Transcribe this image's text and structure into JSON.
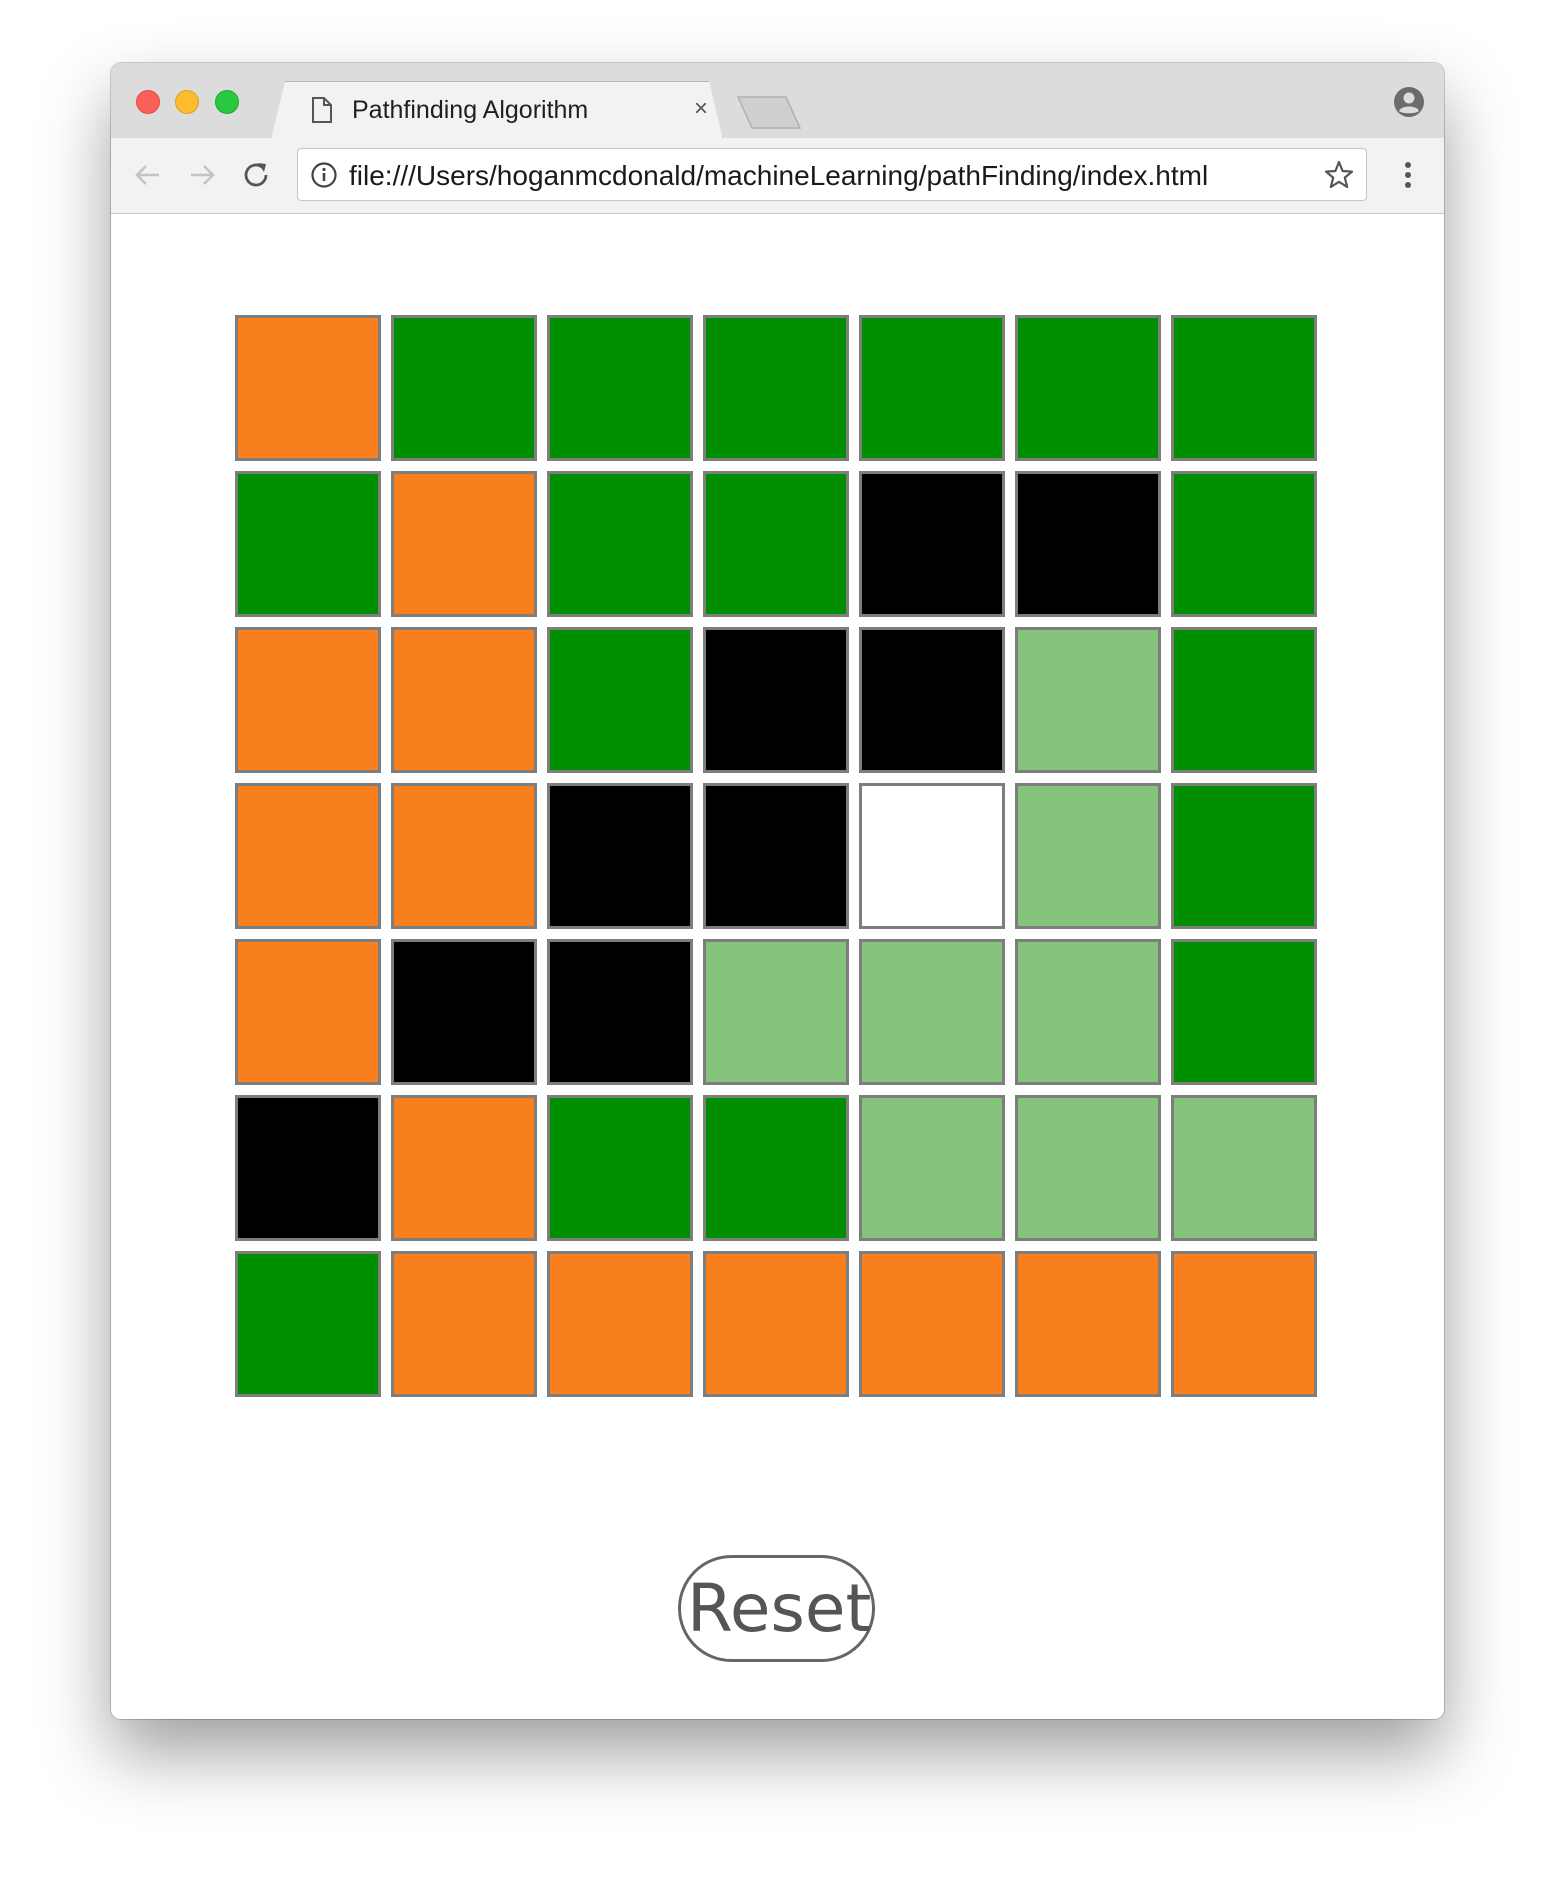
{
  "browser": {
    "tab_title": "Pathfinding Algorithm",
    "tab_close": "×",
    "url": "file:///Users/hoganmcdonald/machineLearning/pathFinding/index.html"
  },
  "icons": {
    "tab": "document-icon",
    "back": "back-arrow-icon",
    "forward": "forward-arrow-icon",
    "reload": "reload-icon",
    "info": "info-icon",
    "bookmark": "star-icon",
    "menu": "kebab-menu-icon",
    "profile": "profile-icon"
  },
  "legend_colors": {
    "path": "#f77f1c",
    "open": "#008f00",
    "wall": "#000000",
    "visited": "#86c47e",
    "empty": "#ffffff"
  },
  "grid": {
    "rows": [
      [
        "path",
        "open",
        "open",
        "open",
        "open",
        "open",
        "open"
      ],
      [
        "open",
        "path",
        "open",
        "open",
        "wall",
        "wall",
        "open"
      ],
      [
        "path",
        "path",
        "open",
        "wall",
        "wall",
        "visited",
        "open"
      ],
      [
        "path",
        "path",
        "wall",
        "wall",
        "empty",
        "visited",
        "open"
      ],
      [
        "path",
        "wall",
        "wall",
        "visited",
        "visited",
        "visited",
        "open"
      ],
      [
        "wall",
        "path",
        "open",
        "open",
        "visited",
        "visited",
        "visited"
      ],
      [
        "open",
        "path",
        "path",
        "path",
        "path",
        "path",
        "path"
      ]
    ]
  },
  "reset_label": "Reset"
}
